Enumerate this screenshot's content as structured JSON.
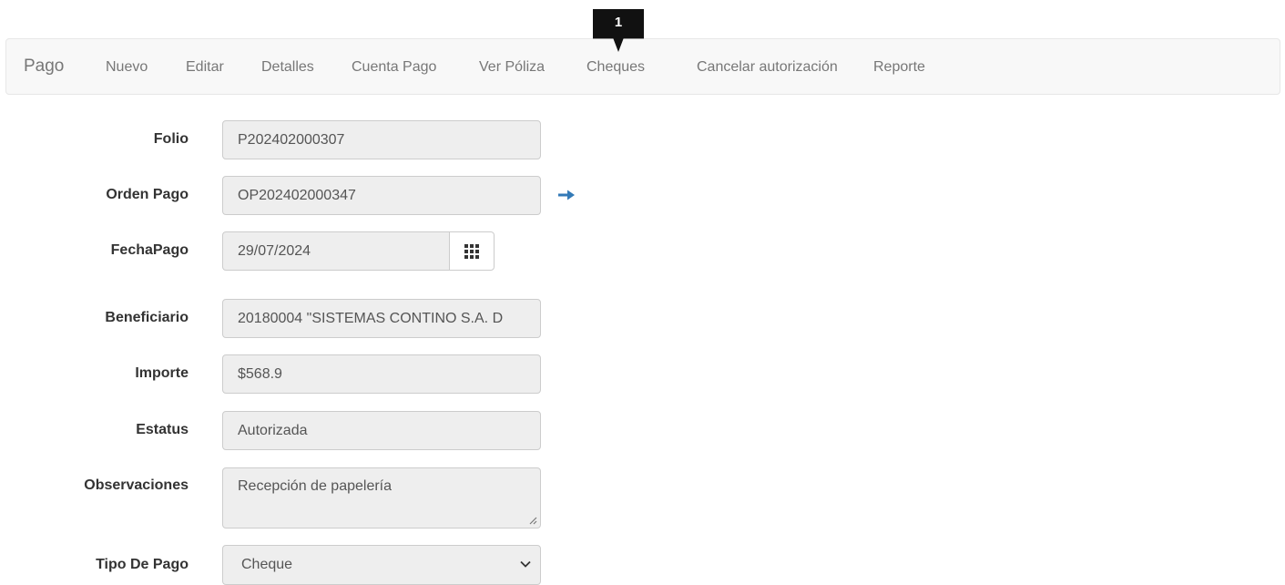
{
  "navbar": {
    "brand": "Pago",
    "items": [
      {
        "label": "Nuevo"
      },
      {
        "label": "Editar"
      },
      {
        "label": "Detalles"
      },
      {
        "label": "Cuenta Pago"
      },
      {
        "label": "Ver Póliza"
      },
      {
        "label": "Cheques"
      },
      {
        "label": "Cancelar autorización"
      },
      {
        "label": "Reporte"
      }
    ]
  },
  "marker": {
    "label": "1"
  },
  "form": {
    "folio": {
      "label": "Folio",
      "value": "P202402000307"
    },
    "orden_pago": {
      "label": "Orden Pago",
      "value": "OP202402000347",
      "link_icon": "arrow-right-icon"
    },
    "fecha_pago": {
      "label": "FechaPago",
      "value": "29/07/2024",
      "picker_icon": "calendar-grid-icon"
    },
    "beneficiario": {
      "label": "Beneficiario",
      "value": "20180004 \"SISTEMAS CONTINO S.A. D"
    },
    "importe": {
      "label": "Importe",
      "value": "$568.9"
    },
    "estatus": {
      "label": "Estatus",
      "value": "Autorizada"
    },
    "observaciones": {
      "label": "Observaciones",
      "value": "Recepción de papelería"
    },
    "tipo_de_pago": {
      "label": "Tipo De Pago",
      "value": "Cheque"
    }
  },
  "colors": {
    "link_arrow": "#337ab7",
    "navbar_bg": "#f8f8f8",
    "field_bg": "#eeeeee"
  }
}
